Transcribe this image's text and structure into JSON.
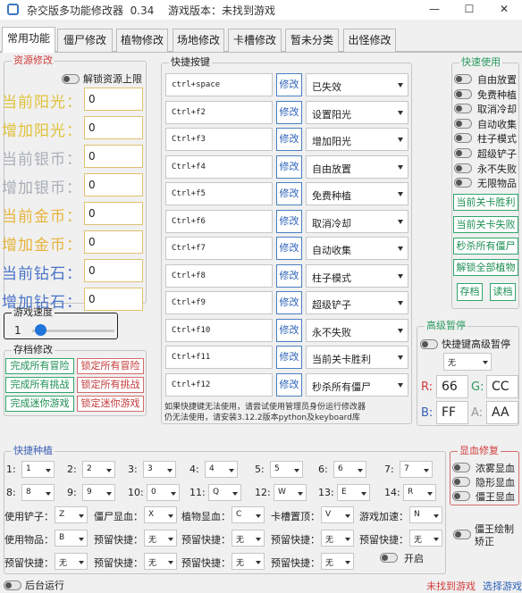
{
  "window": {
    "title": "杂交版多功能修改器  0.34",
    "game_version": "游戏版本：未找到游戏",
    "minimize": "—",
    "maximize": "☐",
    "close": "✕"
  },
  "tabs": [
    "常用功能",
    "僵尸修改",
    "植物修改",
    "场地修改",
    "卡槽修改",
    "暂未分类",
    "出怪修改"
  ],
  "resources": {
    "title": "资源修改",
    "unlock_label": "解锁资源上限",
    "rows": [
      {
        "label": "当前阳光：",
        "value": "0",
        "color": "#e0c23a"
      },
      {
        "label": "增加阳光：",
        "value": "0",
        "color": "#e0c23a"
      },
      {
        "label": "当前银币：",
        "value": "0",
        "color": "#a9b0b8"
      },
      {
        "label": "增加银币：",
        "value": "0",
        "color": "#a9b0b8"
      },
      {
        "label": "当前金币：",
        "value": "0",
        "color": "#e7b43c"
      },
      {
        "label": "增加金币：",
        "value": "0",
        "color": "#e7b43c"
      },
      {
        "label": "当前钻石：",
        "value": "0",
        "color": "#4a74c8"
      },
      {
        "label": "增加钻石：",
        "value": "0",
        "color": "#4a74c8"
      }
    ]
  },
  "speed": {
    "title": "游戏速度",
    "value": "1",
    "level": 0.1
  },
  "save": {
    "title": "存档修改",
    "green_buttons": [
      "完成所有冒险",
      "完成所有挑战",
      "完成迷你游戏"
    ],
    "red_buttons": [
      "锁定所有冒险",
      "锁定所有挑战",
      "锁定迷你游戏"
    ]
  },
  "hotkeys": {
    "title": "快捷按键",
    "edit_label": "修改",
    "rows": [
      {
        "key": "ctrl+space",
        "action": "已失效"
      },
      {
        "key": "Ctrl+f2",
        "action": "设置阳光"
      },
      {
        "key": "Ctrl+f3",
        "action": "增加阳光"
      },
      {
        "key": "Ctrl+f4",
        "action": "自由放置"
      },
      {
        "key": "Ctrl+f5",
        "action": "免费种植"
      },
      {
        "key": "Ctrl+f6",
        "action": "取消冷却"
      },
      {
        "key": "Ctrl+f7",
        "action": "自动收集"
      },
      {
        "key": "Ctrl+f8",
        "action": "柱子模式"
      },
      {
        "key": "Ctrl+f9",
        "action": "超级铲子"
      },
      {
        "key": "Ctrl+f10",
        "action": "永不失败"
      },
      {
        "key": "Ctrl+f11",
        "action": "当前关卡胜利"
      },
      {
        "key": "Ctrl+f12",
        "action": "秒杀所有僵尸"
      }
    ],
    "note_line1": "如果快捷键无法使用，请尝试使用管理员身份运行修改器",
    "note_line2": "仍无法使用，请安装3.12.2版本python及keyboard库"
  },
  "quick_use": {
    "title": "快速使用",
    "toggles": [
      "自由放置",
      "免费种植",
      "取消冷却",
      "自动收集",
      "柱子模式",
      "超级铲子",
      "永不失败",
      "无限物品"
    ],
    "buttons": [
      "当前关卡胜利",
      "当前关卡失败",
      "秒杀所有僵尸",
      "解锁全部植物"
    ],
    "save_btn": "存档",
    "load_btn": "读档"
  },
  "advanced_pause": {
    "title": "高级暂停",
    "toggle_label": "快捷键高级暂停",
    "key_value": "无",
    "r_label": "R:",
    "r": "66",
    "g_label": "G:",
    "g": "CC",
    "b_label": "B:",
    "b": "FF",
    "a_label": "A:",
    "a": "AA"
  },
  "quick_plant": {
    "title": "快捷种植",
    "slots": [
      {
        "label": "1:",
        "value": "1"
      },
      {
        "label": "2:",
        "value": "2"
      },
      {
        "label": "3:",
        "value": "3"
      },
      {
        "label": "4:",
        "value": "4"
      },
      {
        "label": "5:",
        "value": "5"
      },
      {
        "label": "6:",
        "value": "6"
      },
      {
        "label": "7:",
        "value": "7"
      },
      {
        "label": "8:",
        "value": "8"
      },
      {
        "label": "9:",
        "value": "9"
      },
      {
        "label": "10:",
        "value": "0"
      },
      {
        "label": "11:",
        "value": "Q"
      },
      {
        "label": "12:",
        "value": "W"
      },
      {
        "label": "13:",
        "value": "E"
      },
      {
        "label": "14:",
        "value": "R"
      }
    ],
    "row3": [
      {
        "label": "使用铲子：",
        "value": "Z"
      },
      {
        "label": "僵尸显血：",
        "value": "X"
      },
      {
        "label": "植物显血：",
        "value": "C"
      },
      {
        "label": "卡槽置顶：",
        "value": "V"
      },
      {
        "label": "游戏加速：",
        "value": "N"
      }
    ],
    "row4": [
      {
        "label": "使用物品：",
        "value": "B"
      },
      {
        "label": "预留快捷：",
        "value": "无"
      },
      {
        "label": "预留快捷：",
        "value": "无"
      },
      {
        "label": "预留快捷：",
        "value": "无"
      },
      {
        "label": "预留快捷：",
        "value": "无"
      }
    ],
    "row5": [
      {
        "label": "预留快捷：",
        "value": "无"
      },
      {
        "label": "预留快捷：",
        "value": "无"
      },
      {
        "label": "预留快捷：",
        "value": "无"
      },
      {
        "label": "预留快捷：",
        "value": "无"
      }
    ],
    "enable_label": "开启"
  },
  "hp_display": {
    "title": "显血修复",
    "items": [
      "浓雾显血",
      "隐形显血",
      "僵王显血"
    ]
  },
  "boss_fix_line1": "僵王绘制",
  "boss_fix_line2": "矫正",
  "status": {
    "background_run": "后台运行",
    "not_found": "未找到游戏",
    "select_game": "选择游戏"
  },
  "colors": {
    "accent_blue": "#2d63b8",
    "green": "#1d8f52",
    "red": "#c43a3a",
    "title_red": "#d23c3c",
    "title_green": "#2a9a5f",
    "title_blue": "#3b5fb5"
  }
}
